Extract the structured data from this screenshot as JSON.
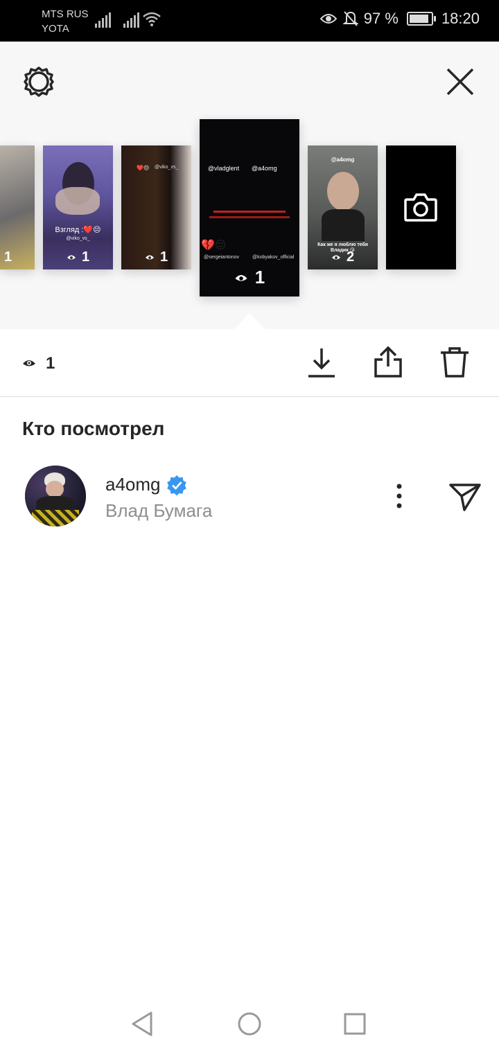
{
  "status_bar": {
    "carrier1": "MTS RUS",
    "carrier2": "YOTA",
    "battery": "97 %",
    "time": "18:20",
    "battery_level": 0.97
  },
  "top": {
    "settings_icon": "gear-icon",
    "close_icon": "close-icon"
  },
  "stories": [
    {
      "views": "1",
      "caption": ""
    },
    {
      "views": "1",
      "caption": "Взгляд :❤️😔",
      "tag": "@viko_vs_"
    },
    {
      "views": "1",
      "caption": "❤️😔",
      "tag": "@viko_vs_"
    },
    {
      "views": "1",
      "tag1": "@vladglent",
      "tag2": "@a4omg",
      "tag3": "@sergeiantonov",
      "tag4": "@kobyakov_official",
      "emoji": "💔😔"
    },
    {
      "views": "2",
      "tag": "@a4omg",
      "caption": "Как же я люблю тебя Владик 😘"
    },
    {
      "camera_icon": "camera-icon"
    }
  ],
  "action_bar": {
    "views_count": "1",
    "download_icon": "download-icon",
    "share_icon": "share-icon",
    "delete_icon": "trash-icon"
  },
  "viewers": {
    "title": "Кто посмотрел",
    "items": [
      {
        "username": "a4omg",
        "full_name": "Влад Бумага",
        "verified": true
      }
    ]
  },
  "colors": {
    "verified": "#3897f0",
    "text": "#262626",
    "secondary": "#8e8e8e"
  }
}
